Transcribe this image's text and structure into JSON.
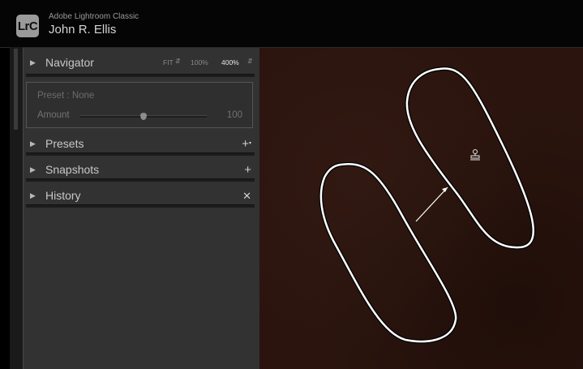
{
  "app": {
    "logo": "LrC",
    "name": "Adobe Lightroom Classic",
    "user": "John R. Ellis"
  },
  "navigator": {
    "title": "Navigator",
    "zoom_fit": "FIT",
    "zoom_100": "100%",
    "zoom_400": "400%",
    "active_zoom": "400%"
  },
  "preset_panel": {
    "preset_label": "Preset : None",
    "amount_label": "Amount",
    "amount_value": "100",
    "amount_fraction": 0.5
  },
  "sections": {
    "presets": {
      "title": "Presets",
      "action_icon": "plus-icon"
    },
    "snapshots": {
      "title": "Snapshots",
      "action_icon": "plus-icon"
    },
    "history": {
      "title": "History",
      "action_icon": "close-icon"
    }
  },
  "canvas": {
    "background_color": "#2b140e",
    "overlay_color": "#ffffff",
    "spot_overlays": [
      "spot-target-outline",
      "spot-source-outline",
      "spot-connector-line"
    ]
  }
}
